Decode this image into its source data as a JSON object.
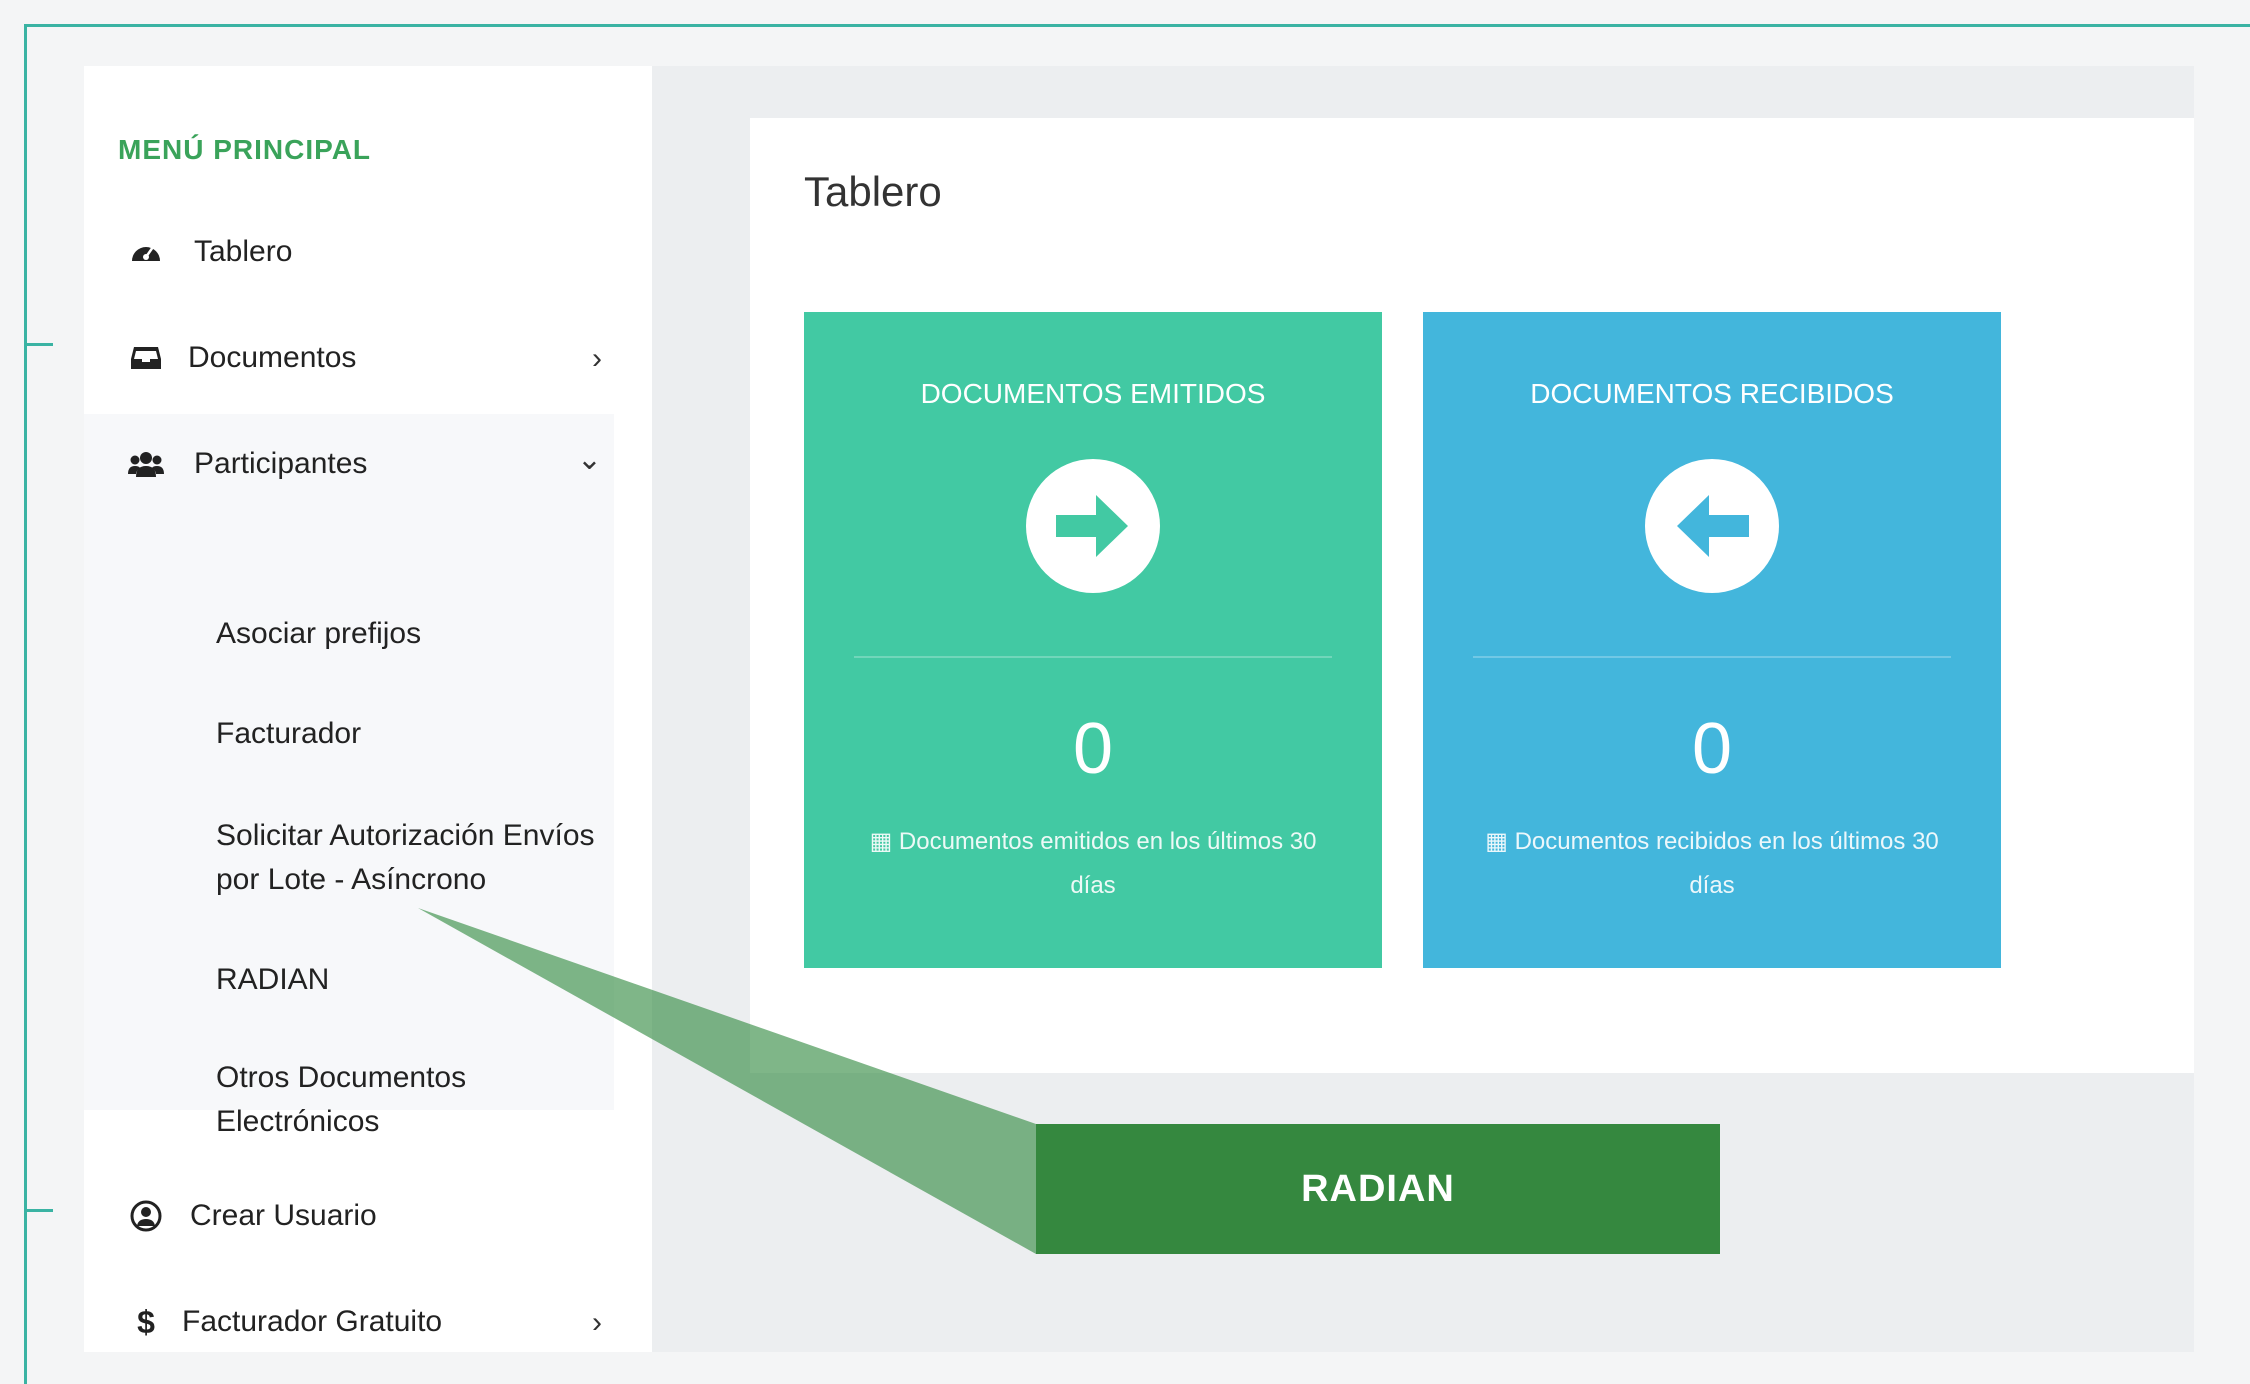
{
  "sidebar": {
    "menu_title": "MENÚ PRINCIPAL",
    "items": [
      {
        "label": "Tablero",
        "icon": "dashboard-icon"
      },
      {
        "label": "Documentos",
        "icon": "inbox-icon"
      },
      {
        "label": "Participantes",
        "icon": "users-icon"
      },
      {
        "label": "Crear Usuario",
        "icon": "user-circle-icon"
      },
      {
        "label": "Facturador Gratuito",
        "icon": "dollar-icon"
      }
    ],
    "chevrons": {
      "collapsed": "›",
      "expanded": "⌄"
    },
    "participantes_subitems": [
      "Asociar prefijos",
      "Facturador",
      "Solicitar Autorización Envíos por Lote - Asíncrono",
      "RADIAN",
      "Otros Documentos Electrónicos"
    ]
  },
  "main": {
    "title": "Tablero",
    "cards": [
      {
        "label": "DOCUMENTOS EMITIDOS",
        "count": "0",
        "description": "Documentos emitidos en los últimos 30 días",
        "icon": "arrow-right-circle-icon",
        "color": "#42c9a3"
      },
      {
        "label": "DOCUMENTOS RECIBIDOS",
        "count": "0",
        "description": "Documentos recibidos en los últimos 30 días",
        "icon": "arrow-left-circle-icon",
        "color": "#43b6dc"
      }
    ]
  },
  "callout": {
    "label": "RADIAN",
    "color": "#35883f"
  },
  "colors": {
    "accent_teal": "#3ab3a3",
    "menu_title": "#3aa35a"
  }
}
